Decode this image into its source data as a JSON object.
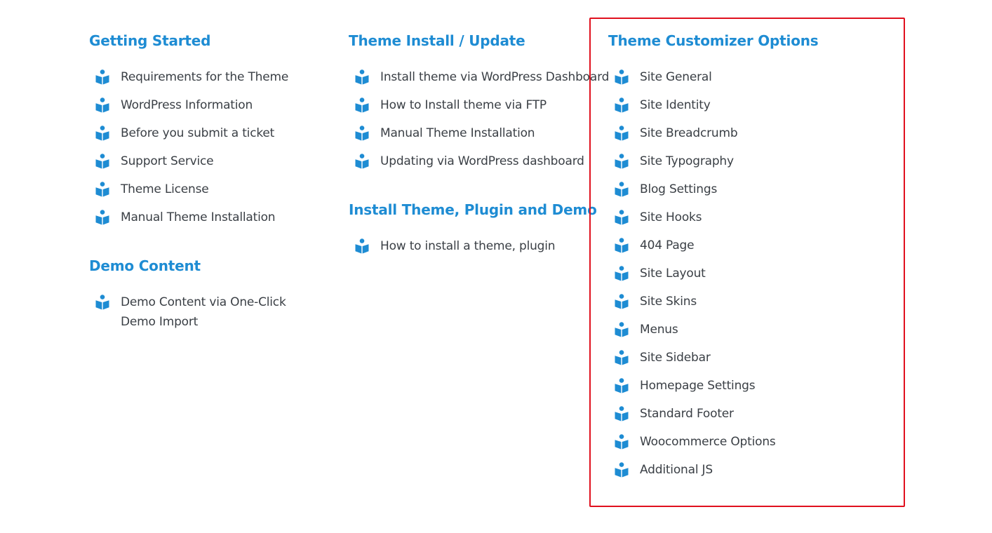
{
  "colors": {
    "heading": "#1e8cd3",
    "icon": "#1e8cd3",
    "text": "#3a3f45",
    "highlight_border": "#e0101e"
  },
  "icon_name": "book-reader-icon",
  "getting_started": {
    "title": "Getting Started",
    "items": [
      "Requirements for the Theme",
      "WordPress Information",
      "Before you submit a ticket",
      "Support Service",
      "Theme License",
      "Manual Theme Installation"
    ]
  },
  "demo_content": {
    "title": "Demo Content",
    "items": [
      "Demo Content via One-Click Demo Import"
    ]
  },
  "theme_install": {
    "title": "Theme Install / Update",
    "items": [
      "Install theme via WordPress Dashboard",
      "How to Install theme via FTP",
      "Manual Theme Installation",
      "Updating via WordPress dashboard"
    ]
  },
  "install_plugin_demo": {
    "title": "Install Theme, Plugin and Demo",
    "items": [
      "How to install a theme, plugin"
    ]
  },
  "customizer": {
    "title": "Theme Customizer Options",
    "items": [
      "Site General",
      "Site Identity",
      "Site Breadcrumb",
      "Site Typography",
      "Blog Settings",
      "Site Hooks",
      "404 Page",
      "Site Layout",
      "Site Skins",
      "Menus",
      "Site Sidebar",
      "Homepage Settings",
      "Standard Footer",
      "Woocommerce Options",
      "Additional JS"
    ]
  }
}
